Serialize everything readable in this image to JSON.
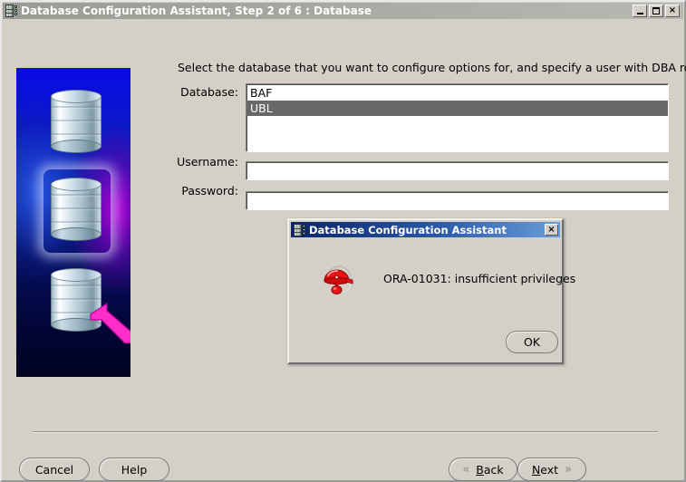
{
  "window": {
    "title": "Database Configuration Assistant, Step 2 of 6 : Database",
    "icon": "database-icon",
    "controls": {
      "minimize": "_",
      "maximize": "□",
      "close": "×"
    }
  },
  "wizard": {
    "instruction": "Select the database that you want to configure options for, and specify a user with DBA role:",
    "graphic": {
      "name": "database-stack-graphic",
      "background_start": "#0a0ae8",
      "background_end": "#01031f",
      "accent_purple": "#be00dc",
      "arrow_color": "#ff2ec8",
      "cylinder_count": 3,
      "highlighted_cylinder": 2
    },
    "fields": {
      "database_label": "Database:",
      "username_label": "Username:",
      "password_label": "Password:",
      "username_value": "",
      "username_placeholder": "",
      "password_value": "",
      "password_placeholder": ""
    },
    "database_list": [
      {
        "label": "BAF",
        "selected": false
      },
      {
        "label": "UBL",
        "selected": true
      }
    ],
    "selection_color": "#686868"
  },
  "buttons": {
    "cancel": "Cancel",
    "help": "Help",
    "back": "Back",
    "back_mnemonic": "B",
    "back_chevron": "«",
    "next": "Next",
    "next_mnemonic": "N",
    "next_chevron": "»"
  },
  "dialog": {
    "title": "Database Configuration Assistant",
    "icon": "database-icon",
    "close_label": "×",
    "alert_icon": "alarm-bell-icon",
    "alert_color": "#e81414",
    "message": "ORA-01031: insufficient privileges",
    "ok_label": "OK",
    "titlebar_gradient_start": "#0a246a",
    "titlebar_gradient_end": "#6a9ed8"
  }
}
